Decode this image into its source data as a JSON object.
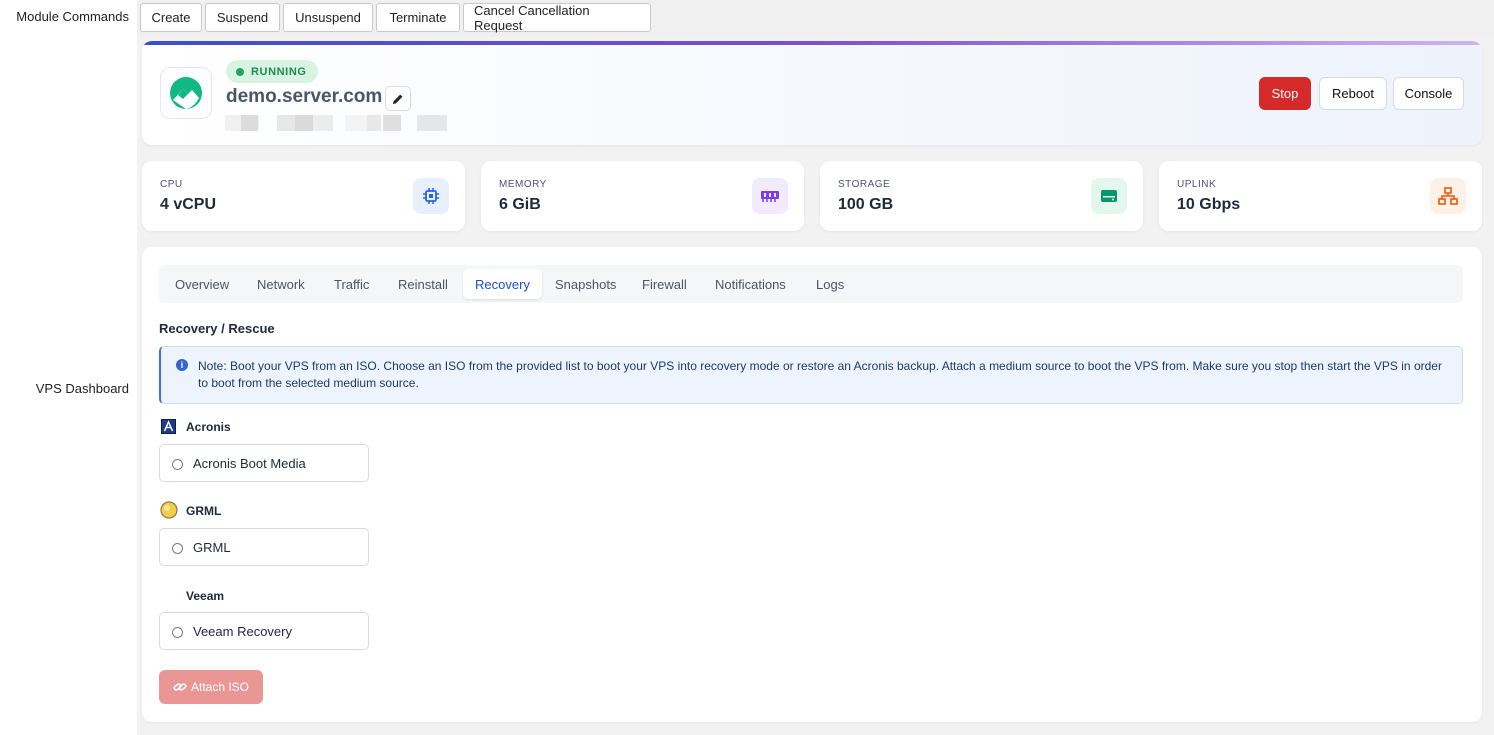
{
  "left_labels": {
    "module_commands": "Module Commands",
    "vps_dashboard": "VPS Dashboard"
  },
  "module_commands": [
    "Create",
    "Suspend",
    "Unsuspend",
    "Terminate",
    "Cancel Cancellation Request"
  ],
  "server": {
    "status": "RUNNING",
    "hostname": "demo.server.com"
  },
  "actions": {
    "stop": "Stop",
    "reboot": "Reboot",
    "console": "Console"
  },
  "stats": [
    {
      "label": "CPU",
      "value": "4 vCPU",
      "icon": "chip-icon",
      "color": "#2563eb"
    },
    {
      "label": "MEMORY",
      "value": "6 GiB",
      "icon": "memory-icon",
      "color": "#7c3aed"
    },
    {
      "label": "STORAGE",
      "value": "100 GB",
      "icon": "storage-icon",
      "color": "#059669"
    },
    {
      "label": "UPLINK",
      "value": "10 Gbps",
      "icon": "network-icon",
      "color": "#ea580c"
    }
  ],
  "tabs": [
    "Overview",
    "Network",
    "Traffic",
    "Reinstall",
    "Recovery",
    "Snapshots",
    "Firewall",
    "Notifications",
    "Logs"
  ],
  "active_tab": "Recovery",
  "recovery": {
    "title": "Recovery / Rescue",
    "note": "Note: Boot your VPS from an ISO. Choose an ISO from the provided list to boot your VPS into recovery mode or restore an Acronis backup. Attach a medium source to boot the VPS from. Make sure you stop then start the VPS in order to boot from the selected medium source.",
    "groups": [
      {
        "title": "Acronis",
        "option": "Acronis Boot Media"
      },
      {
        "title": "GRML",
        "option": "GRML"
      },
      {
        "title": "Veeam",
        "option": "Veeam Recovery"
      }
    ],
    "attach_button": "Attach ISO"
  },
  "colors": {
    "accent": "#1d4ed8",
    "danger": "#d42a2a",
    "running": "#22a45a"
  }
}
